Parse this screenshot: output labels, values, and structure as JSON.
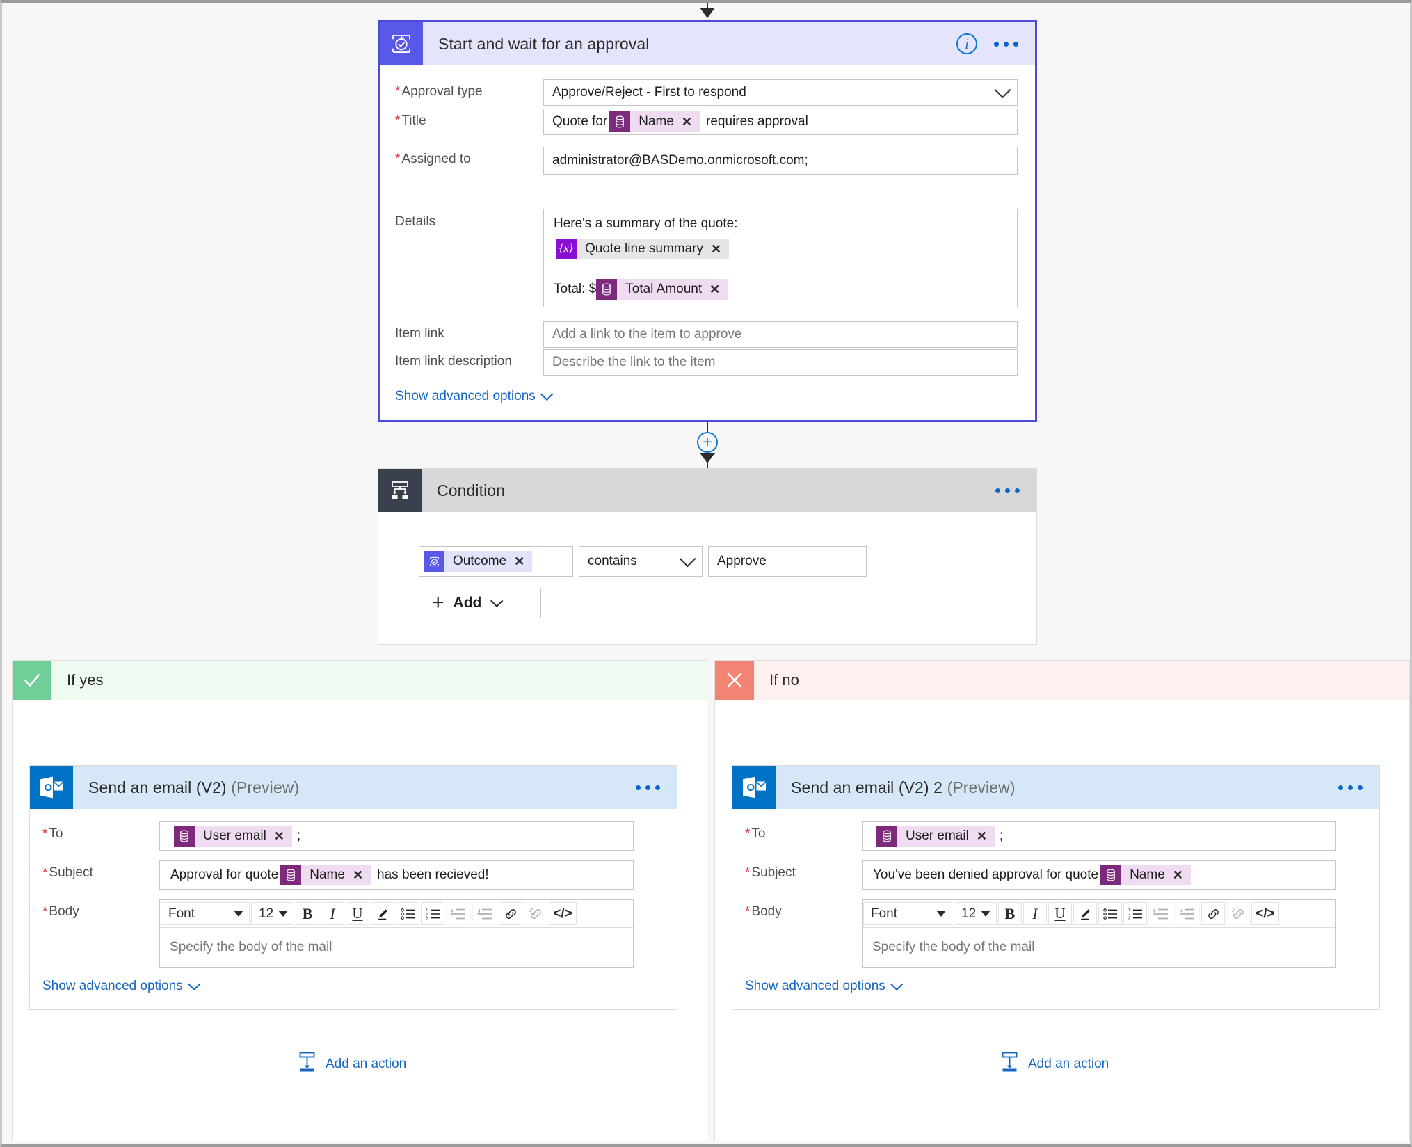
{
  "approval_card": {
    "title": "Start and wait for an approval",
    "icon": "approval-icon",
    "info_icon": "i",
    "fields": {
      "approval_type": {
        "label": "Approval type",
        "required": true,
        "value": "Approve/Reject - First to respond"
      },
      "title": {
        "label": "Title",
        "required": true,
        "prefix": "Quote for",
        "token": "Name",
        "suffix": "requires approval"
      },
      "assigned_to": {
        "label": "Assigned to",
        "required": true,
        "value": "administrator@BASDemo.onmicrosoft.com;"
      },
      "details": {
        "label": "Details",
        "required": false,
        "line1": "Here's a summary of the quote:",
        "token1": "Quote line summary",
        "token1_icon": "{x}",
        "line2_prefix": "Total: $",
        "token2": "Total Amount"
      },
      "item_link": {
        "label": "Item link",
        "required": false,
        "placeholder": "Add a link to the item to approve"
      },
      "item_link_description": {
        "label": "Item link description",
        "required": false,
        "placeholder": "Describe the link to the item"
      }
    },
    "advanced_link": "Show advanced options"
  },
  "condition_card": {
    "title": "Condition",
    "icon": "condition-icon",
    "operand_token": "Outcome",
    "operator": "contains",
    "value": "Approve",
    "add_button": "Add"
  },
  "branch_yes": {
    "label": "If yes",
    "badge": "check-icon",
    "badge_color": "#6fcf97",
    "header_bg": "#effaf1",
    "email": {
      "title": "Send an email (V2)",
      "preview": "(Preview)",
      "icon": "outlook-icon",
      "to": {
        "label": "To",
        "required": true,
        "token": "User email",
        "trailing": ";"
      },
      "subject": {
        "label": "Subject",
        "required": true,
        "prefix": "Approval for quote",
        "token": "Name",
        "suffix": "has been recieved!"
      },
      "body": {
        "label": "Body",
        "required": true,
        "placeholder": "Specify the body of the mail"
      },
      "advanced_link": "Show advanced options"
    },
    "add_action": "Add an action"
  },
  "branch_no": {
    "label": "If no",
    "badge": "close-icon",
    "badge_color": "#f58374",
    "header_bg": "#fdf0ee",
    "email": {
      "title": "Send an email (V2) 2",
      "preview": "(Preview)",
      "icon": "outlook-icon",
      "to": {
        "label": "To",
        "required": true,
        "token": "User email",
        "trailing": ";"
      },
      "subject": {
        "label": "Subject",
        "required": true,
        "prefix": "You've been denied approval for quote",
        "token": "Name",
        "suffix": ""
      },
      "body": {
        "label": "Body",
        "required": true,
        "placeholder": "Specify the body of the mail"
      },
      "advanced_link": "Show advanced options"
    },
    "add_action": "Add an action"
  },
  "rte_toolbar": {
    "font_label": "Font",
    "size_label": "12",
    "buttons": [
      {
        "name": "bold",
        "glyph": "B"
      },
      {
        "name": "italic",
        "glyph": "I"
      },
      {
        "name": "underline",
        "glyph": "U"
      },
      {
        "name": "text-color",
        "glyph": "pen"
      },
      {
        "name": "bulleted-list",
        "glyph": "ul"
      },
      {
        "name": "numbered-list",
        "glyph": "ol"
      },
      {
        "name": "indent",
        "glyph": "indent"
      },
      {
        "name": "outdent",
        "glyph": "outdent"
      },
      {
        "name": "link",
        "glyph": "link"
      },
      {
        "name": "unlink",
        "glyph": "unlink"
      },
      {
        "name": "code-view",
        "glyph": "</>"
      }
    ]
  },
  "colors": {
    "approval_purple": "#5a58e8",
    "approval_header_bg": "#e4e4fb",
    "condition_dark": "#3a404d",
    "condition_header_bg": "#d8d8d8",
    "outlook_blue": "#0072c6",
    "email_header_bg": "#d6e8f7",
    "link_blue": "#1566c0",
    "token_purple": "#7d2a7d",
    "token_bg": "#f0dcf0",
    "variable_purple": "#8a0fd4"
  }
}
